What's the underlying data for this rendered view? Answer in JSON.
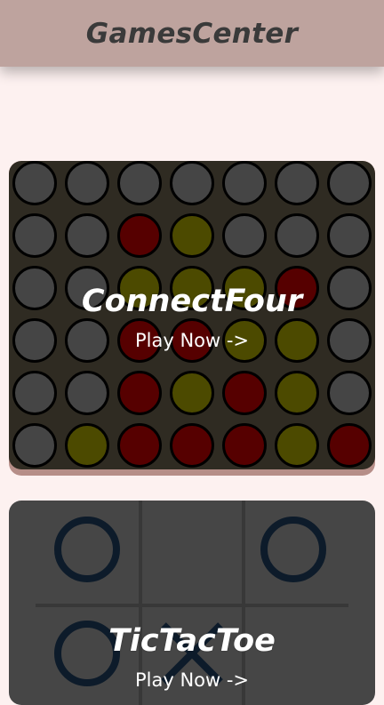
{
  "header": {
    "title": "GamesCenter"
  },
  "games": [
    {
      "title": "ConnectFour",
      "cta": "Play Now ->"
    },
    {
      "title": "TicTacToe",
      "cta": "Play Now ->"
    }
  ],
  "connect_four": {
    "colors": {
      "empty": "#454545",
      "red": "#560000",
      "yellow": "#4c4a00",
      "board": "#2f2b22"
    },
    "grid": [
      [
        "empty",
        "empty",
        "empty",
        "empty",
        "empty",
        "empty",
        "empty"
      ],
      [
        "empty",
        "empty",
        "red",
        "yellow",
        "empty",
        "empty",
        "empty"
      ],
      [
        "empty",
        "empty",
        "yellow",
        "yellow",
        "yellow",
        "red",
        "empty"
      ],
      [
        "empty",
        "empty",
        "red",
        "red",
        "yellow",
        "yellow",
        "empty"
      ],
      [
        "empty",
        "empty",
        "red",
        "yellow",
        "red",
        "yellow",
        "empty"
      ],
      [
        "empty",
        "yellow",
        "red",
        "red",
        "red",
        "yellow",
        "red"
      ]
    ]
  },
  "tic_tac_toe": {
    "colors": {
      "background": "#464646",
      "lines": "#383838",
      "mark": "#0d1b2a"
    },
    "cells": [
      [
        "O",
        "",
        "O"
      ],
      [
        "O",
        "X",
        ""
      ],
      [
        "",
        "",
        ""
      ]
    ]
  }
}
